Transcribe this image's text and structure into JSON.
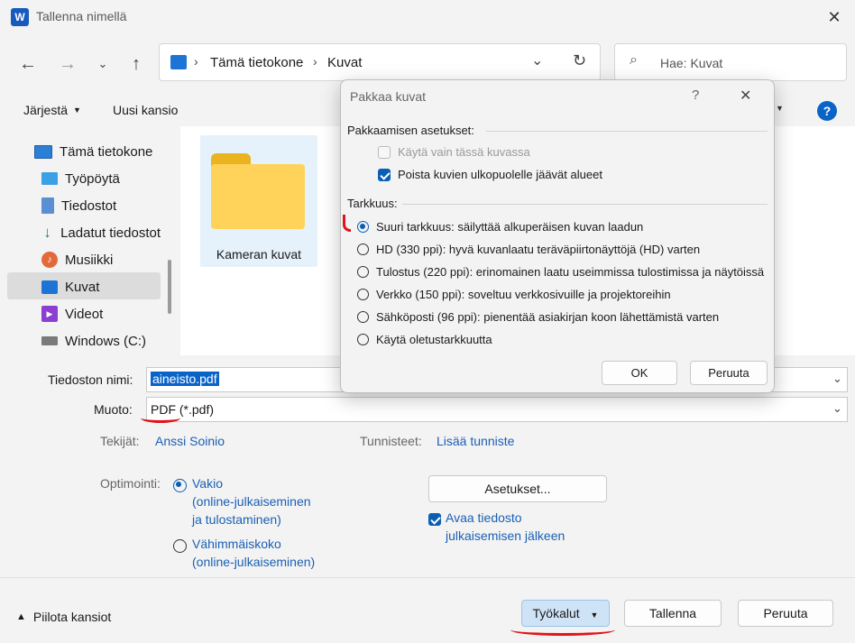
{
  "window": {
    "title": "Tallenna nimellä"
  },
  "nav": {
    "breadcrumb": [
      "Tämä tietokone",
      "Kuvat"
    ],
    "search_placeholder": "Hae: Kuvat"
  },
  "toolbar": {
    "organize": "Järjestä",
    "new_folder": "Uusi kansio"
  },
  "sidebar": {
    "items": [
      {
        "label": "Tämä tietokone",
        "icon": "monitor-icon"
      },
      {
        "label": "Työpöytä",
        "icon": "desktop-icon"
      },
      {
        "label": "Tiedostot",
        "icon": "documents-icon"
      },
      {
        "label": "Ladatut tiedostot",
        "icon": "download-icon"
      },
      {
        "label": "Musiikki",
        "icon": "music-icon"
      },
      {
        "label": "Kuvat",
        "icon": "pictures-icon"
      },
      {
        "label": "Videot",
        "icon": "videos-icon"
      },
      {
        "label": "Windows (C:)",
        "icon": "drive-icon"
      }
    ]
  },
  "content": {
    "folder_name": "Kameran kuvat"
  },
  "form": {
    "filename_label": "Tiedoston nimi:",
    "filename_value": "aineisto.pdf",
    "format_label": "Muoto:",
    "format_value": "PDF (*.pdf)",
    "authors_label": "Tekijät:",
    "authors_value": "Anssi Soinio",
    "tags_label": "Tunnisteet:",
    "tags_value": "Lisää tunniste",
    "optimize_label": "Optimointi:",
    "opt_standard": "Vakio",
    "opt_standard_desc1": "(online-julkaiseminen",
    "opt_standard_desc2": "ja tulostaminen)",
    "opt_min": "Vähimmäiskoko",
    "opt_min_desc": "(online-julkaiseminen)",
    "settings_button": "Asetukset...",
    "open_after_1": "Avaa tiedosto",
    "open_after_2": "julkaisemisen jälkeen"
  },
  "footer": {
    "hide_folders": "Piilota kansiot",
    "tools": "Työkalut",
    "save": "Tallenna",
    "cancel": "Peruuta"
  },
  "dialog": {
    "title": "Pakkaa kuvat",
    "help": "?",
    "settings_header": "Pakkaamisen asetukset:",
    "opt_only_this": "Käytä vain tässä kuvassa",
    "opt_delete_cropped": "Poista kuvien ulkopuolelle jäävät alueet",
    "resolution_header": "Tarkkuus:",
    "res_options": [
      "Suuri tarkkuus: säilyttää alkuperäisen kuvan laadun",
      "HD (330 ppi): hyvä kuvanlaatu teräväpiirtonäyttöjä (HD) varten",
      "Tulostus (220 ppi): erinomainen laatu useimmissa tulostimissa ja näytöissä",
      "Verkko (150 ppi): soveltuu verkkosivuille ja projektoreihin",
      "Sähköposti (96 ppi): pienentää asiakirjan koon lähettämistä varten",
      "Käytä oletustarkkuutta"
    ],
    "ok": "OK",
    "cancel": "Peruuta"
  }
}
